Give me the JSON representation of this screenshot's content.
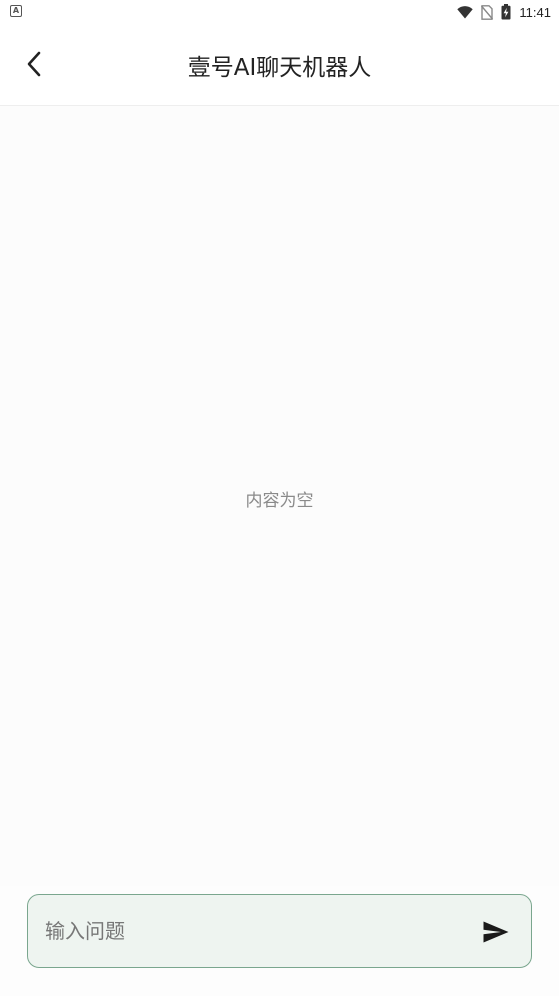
{
  "status_bar": {
    "notification_icon": "a-box-icon",
    "notification_glyph": "A",
    "icons": [
      "wifi-icon",
      "no-sim-icon",
      "battery-charging-icon"
    ],
    "time": "11:41"
  },
  "header": {
    "back_icon": "chevron-left-icon",
    "title": "壹号AI聊天机器人"
  },
  "chat": {
    "empty_text": "内容为空"
  },
  "input_bar": {
    "value": "",
    "placeholder": "输入问题",
    "send_icon": "send-icon"
  },
  "colors": {
    "input_border": "#7aa68e",
    "input_background": "#eef4f0",
    "title_text": "#222222",
    "empty_text": "#8a8a8a"
  }
}
